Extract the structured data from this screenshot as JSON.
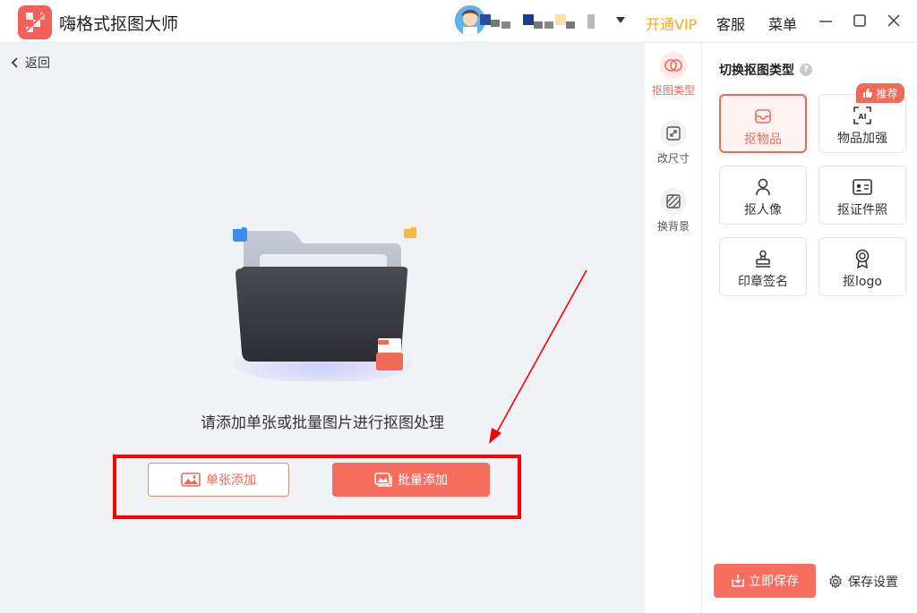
{
  "app": {
    "title": "嗨格式抠图大师"
  },
  "header": {
    "vip_label": "开通VIP",
    "service_label": "客服",
    "menu_label": "菜单"
  },
  "main": {
    "back_label": "返回",
    "prompt": "请添加单张或批量图片进行抠图处理",
    "single_add_label": "单张添加",
    "batch_add_label": "批量添加"
  },
  "rail": {
    "items": [
      {
        "label": "抠图类型"
      },
      {
        "label": "改尺寸"
      },
      {
        "label": "换背景"
      }
    ]
  },
  "panel": {
    "title": "切换抠图类型",
    "help_glyph": "?",
    "badge_label": "推荐",
    "types": [
      {
        "label": "抠物品"
      },
      {
        "label": "物品加强"
      },
      {
        "label": "抠人像"
      },
      {
        "label": "抠证件照"
      },
      {
        "label": "印章签名"
      },
      {
        "label": "抠logo"
      }
    ],
    "save_now_label": "立即保存",
    "save_settings_label": "保存设置"
  },
  "colors": {
    "accent": "#f76e5e",
    "vip": "#f5a623",
    "highlight": "#ff0000"
  }
}
